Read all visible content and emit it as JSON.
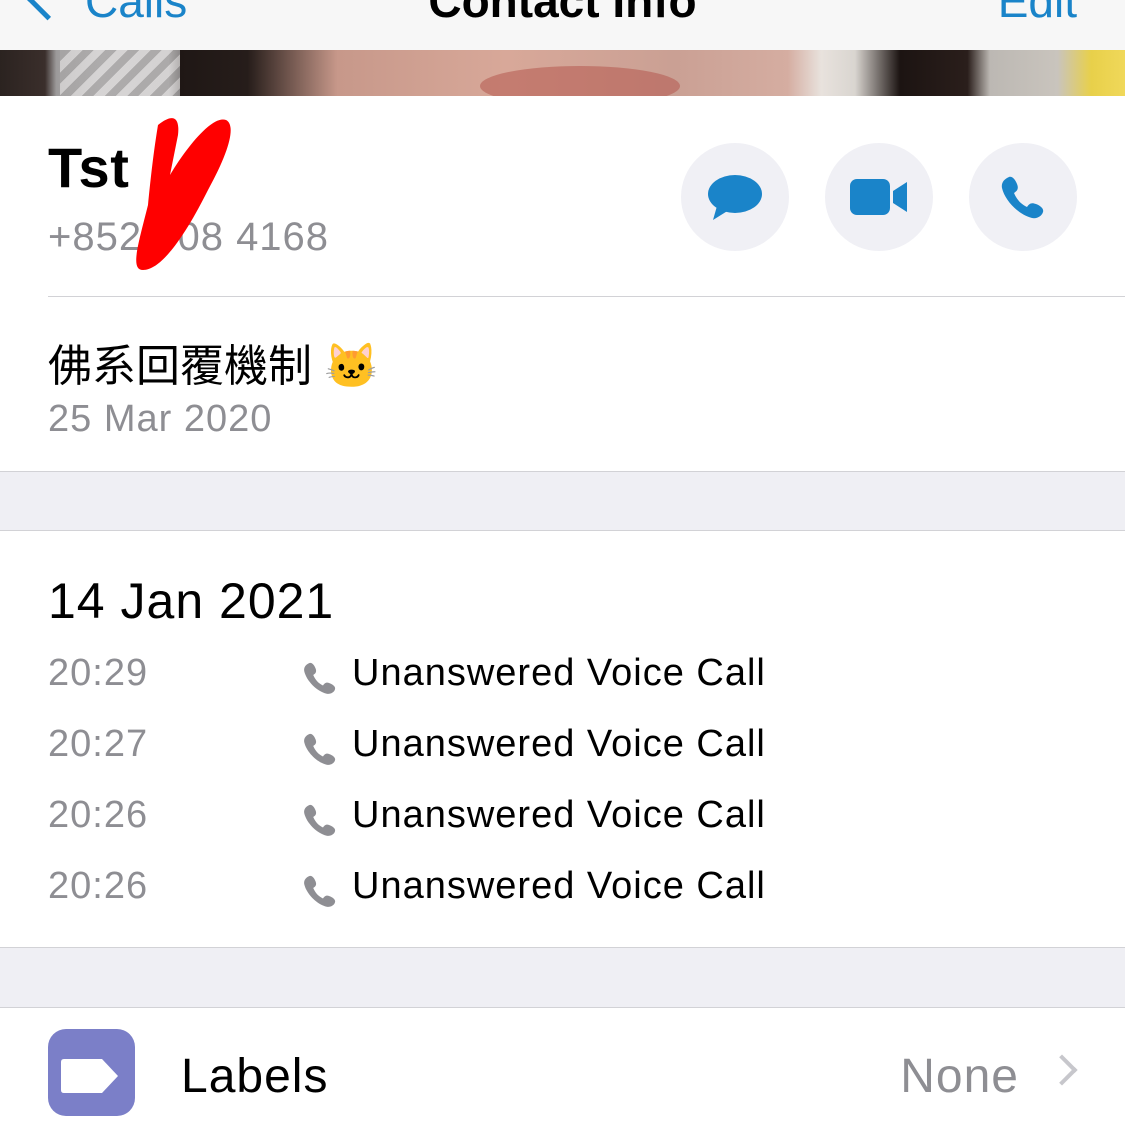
{
  "nav": {
    "back_label": "Calls",
    "title": "Contact Info",
    "edit_label": "Edit"
  },
  "contact": {
    "name": "Tst",
    "phone": "+852 408 4168"
  },
  "actions": [
    {
      "name": "message",
      "icon": "chat-bubble-icon"
    },
    {
      "name": "video",
      "icon": "video-camera-icon"
    },
    {
      "name": "call",
      "icon": "phone-icon"
    }
  ],
  "about": {
    "text": "佛系回覆機制 🐱",
    "date": "25 Mar 2020"
  },
  "calls": {
    "date": "14 Jan 2021",
    "items": [
      {
        "time": "20:29",
        "description": "Unanswered Voice Call"
      },
      {
        "time": "20:27",
        "description": "Unanswered Voice Call"
      },
      {
        "time": "20:26",
        "description": "Unanswered Voice Call"
      },
      {
        "time": "20:26",
        "description": "Unanswered Voice Call"
      }
    ]
  },
  "labels": {
    "label": "Labels",
    "value": "None"
  },
  "colors": {
    "accent": "#1a84c9",
    "secondary_text": "#8e8e93",
    "labels_icon_bg": "#7b7fc8",
    "redaction": "#ff0000"
  }
}
